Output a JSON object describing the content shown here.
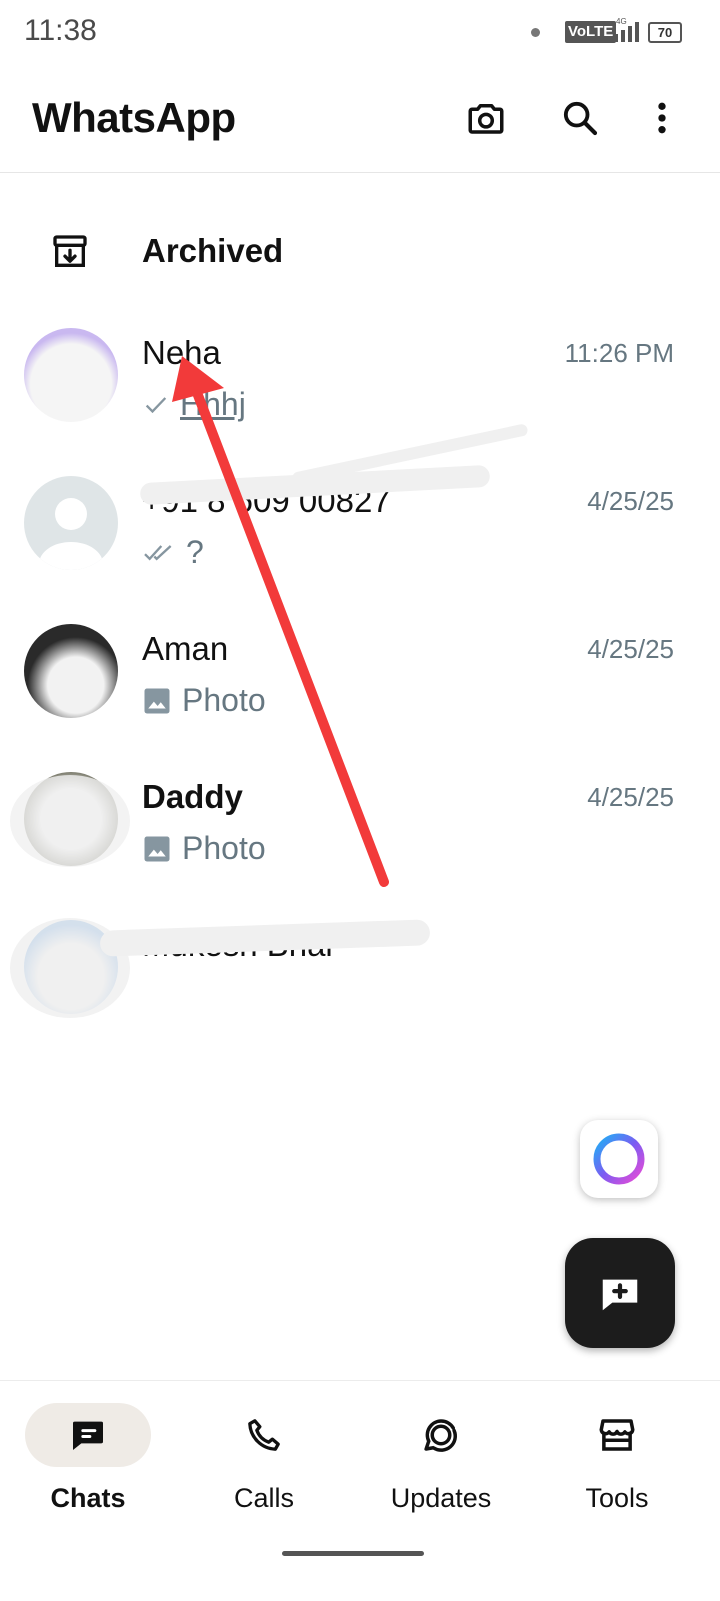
{
  "status_bar": {
    "time": "11:38",
    "network": "VoLTE",
    "signal": "4G",
    "battery": "70"
  },
  "header": {
    "title": "WhatsApp",
    "icons": [
      "camera-icon",
      "search-icon",
      "more-vert-icon"
    ]
  },
  "archived": {
    "label": "Archived"
  },
  "chats": [
    {
      "name": "Neha",
      "time": "11:26 PM",
      "preview": "Hhhj",
      "status": "single-tick"
    },
    {
      "name": "+91 8 609 00827",
      "time": "4/25/25",
      "preview": "?",
      "status": "double-tick"
    },
    {
      "name": "Aman",
      "time": "4/25/25",
      "preview": "Photo",
      "status": "photo"
    },
    {
      "name": "Daddy",
      "time": "4/25/25",
      "preview": "Photo",
      "status": "photo"
    },
    {
      "name": "Mukesh Bhai",
      "time": "",
      "preview": "",
      "status": ""
    }
  ],
  "bottom_nav": [
    {
      "label": "Chats",
      "icon": "chats-icon",
      "active": true
    },
    {
      "label": "Calls",
      "icon": "phone-icon",
      "active": false
    },
    {
      "label": "Updates",
      "icon": "updates-icon",
      "active": false
    },
    {
      "label": "Tools",
      "icon": "store-icon",
      "active": false
    }
  ],
  "colors": {
    "accent_dark": "#1c1c1c",
    "muted_text": "#667781",
    "annotation_arrow": "#f23a3a",
    "nav_active_bg": "#efebe6"
  }
}
